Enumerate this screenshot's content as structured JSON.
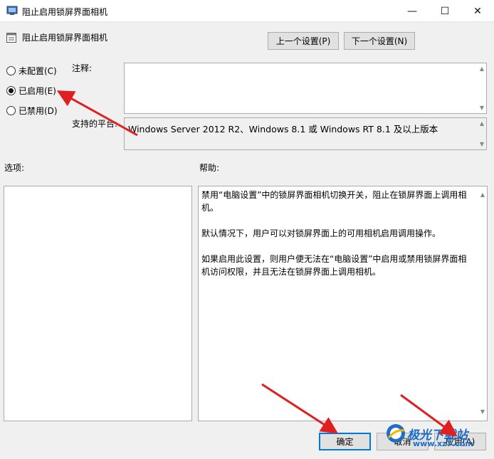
{
  "window": {
    "title": "阻止启用锁屏界面相机",
    "minimize_glyph": "—",
    "maximize_glyph": "☐",
    "close_glyph": "✕"
  },
  "policy_name": "阻止启用锁屏界面相机",
  "nav": {
    "prev_label": "上一个设置(P)",
    "next_label": "下一个设置(N)"
  },
  "state": {
    "options": [
      {
        "label": "未配置(C)",
        "selected": false
      },
      {
        "label": "已启用(E)",
        "selected": true
      },
      {
        "label": "已禁用(D)",
        "selected": false
      }
    ]
  },
  "labels": {
    "comment": "注释:",
    "supported_on": "支持的平台:",
    "options": "选项:",
    "help": "帮助:"
  },
  "comment_value": "",
  "supported_value": "Windows Server 2012 R2、Windows 8.1 或 Windows RT 8.1 及以上版本",
  "help_paragraphs": [
    "禁用“电脑设置”中的锁屏界面相机切换开关，阻止在锁屏界面上调用相机。",
    "默认情况下，用户可以对锁屏界面上的可用相机启用调用操作。",
    "如果启用此设置，则用户便无法在“电脑设置”中启用或禁用锁屏界面相机访问权限，并且无法在锁屏界面上调用相机。"
  ],
  "footer": {
    "ok_label": "确定",
    "cancel_label": "取消",
    "apply_label": "应用(A)"
  },
  "watermark": {
    "text": "极光下载站",
    "url": "www.xz7.com"
  },
  "colors": {
    "annotation_arrow": "#e02020",
    "accent": "#0078d7"
  }
}
